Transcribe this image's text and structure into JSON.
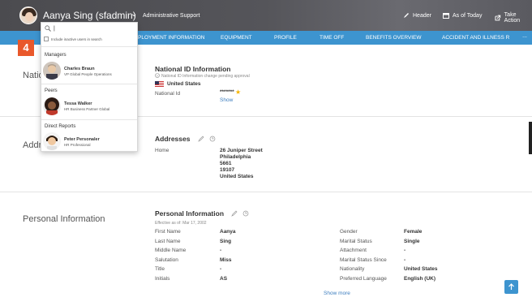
{
  "header": {
    "user_name": "Aanya Sing (sfadmin)",
    "user_role": "Administrative Support",
    "actions": [
      {
        "label": "Header",
        "icon": "pencil-icon"
      },
      {
        "label": "As of Today",
        "icon": "calendar-icon"
      },
      {
        "label": "Take Action",
        "icon": "external-icon"
      }
    ]
  },
  "nav": {
    "items": [
      "PLOYMENT INFORMATION",
      "EQUIPMENT",
      "PROFILE",
      "TIME OFF",
      "BENEFITS OVERVIEW",
      "ACCIDENT AND ILLNESS R"
    ],
    "more": "..."
  },
  "step_badge": "4",
  "dropdown": {
    "search_value": "",
    "include_inactive": "Include inactive users in search",
    "groups": [
      {
        "label": "Managers",
        "people": [
          {
            "name": "Charles Braun",
            "title": "VP Global People Operations"
          }
        ]
      },
      {
        "label": "Peers",
        "people": [
          {
            "name": "Tessa Walker",
            "title": "HR Business Partner Global"
          }
        ]
      },
      {
        "label": "Direct Reports",
        "people": [
          {
            "name": "Peter Personaler",
            "title": "HR Professional"
          }
        ]
      }
    ]
  },
  "national_id": {
    "section_title": "National ID Information",
    "section_title_truncated": "Natio",
    "card_title": "National ID Information",
    "pending_note": "National ID Information change pending approval",
    "country": "United States",
    "label": "National Id",
    "value": "*******",
    "show_link": "Show"
  },
  "addresses": {
    "section_title_truncated": "Addr",
    "card_title": "Addresses",
    "label": "Home",
    "lines": [
      "26 Juniper Street",
      "Philadelphia",
      "5661",
      "19107",
      "United States"
    ]
  },
  "personal": {
    "section_title": "Personal Information",
    "card_title": "Personal Information",
    "effective": "Effective as of: Mar 17, 2002",
    "left_fields": [
      {
        "label": "First Name",
        "value": "Aanya"
      },
      {
        "label": "Last Name",
        "value": "Sing"
      },
      {
        "label": "Middle Name",
        "value": "-"
      },
      {
        "label": "Salutation",
        "value": "Miss"
      },
      {
        "label": "Title",
        "value": "-"
      },
      {
        "label": "Initials",
        "value": "AS"
      }
    ],
    "right_fields": [
      {
        "label": "Gender",
        "value": "Female"
      },
      {
        "label": "Marital Status",
        "value": "Single"
      },
      {
        "label": "Attachment",
        "value": "-"
      },
      {
        "label": "Marital Status Since",
        "value": "-"
      },
      {
        "label": "Nationality",
        "value": "United States"
      },
      {
        "label": "Preferred Language",
        "value": "English (UK)"
      }
    ],
    "show_more": "Show more"
  },
  "colors": {
    "accent": "#3d94cf",
    "badge": "#e9582b",
    "star": "#f5b400"
  }
}
